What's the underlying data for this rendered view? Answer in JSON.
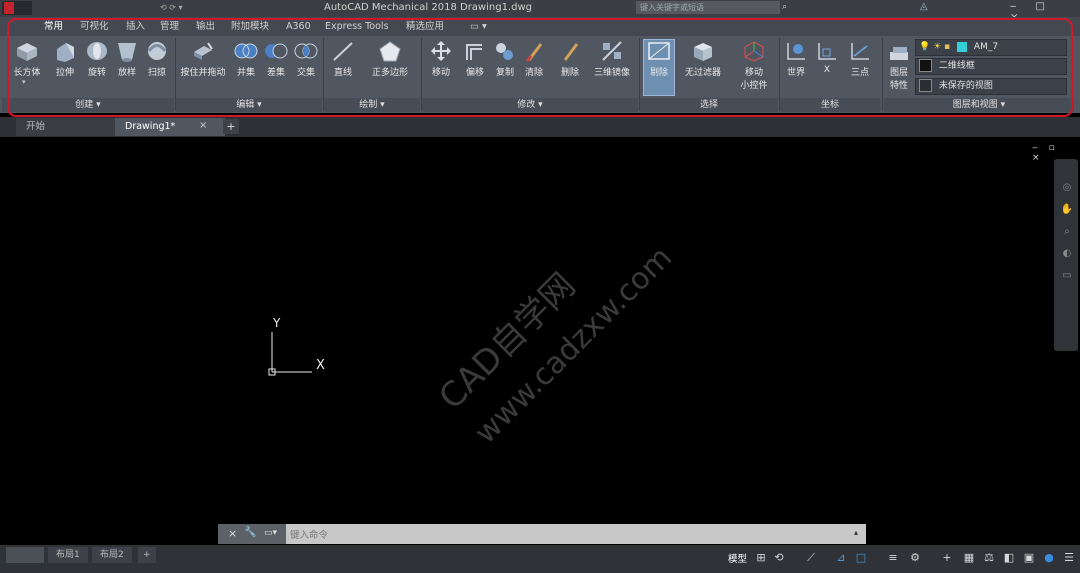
{
  "titlebar": {
    "title": "AutoCAD Mechanical 2018      Drawing1.dwg",
    "search_placeholder": "键入关键字或短语"
  },
  "ribbon_tabs": [
    "常用",
    "可视化",
    "插入",
    "管理",
    "输出",
    "附加模块",
    "A360",
    "Express Tools",
    "精选应用",
    "▭ ▾"
  ],
  "panels": {
    "create": {
      "title": "创建 ▾",
      "tools": [
        "长方体",
        "拉伸",
        "旋转",
        "放样",
        "扫掠"
      ]
    },
    "edit": {
      "title": "编辑 ▾",
      "tools": [
        "按住并拖动",
        "并集",
        "差集",
        "交集"
      ]
    },
    "draw": {
      "title": "绘制 ▾",
      "tools": [
        "直线",
        "正多边形"
      ]
    },
    "modify": {
      "title": "修改 ▾",
      "tools": [
        "移动",
        "偏移",
        "复制",
        "清除",
        "删除",
        "三维镜像"
      ]
    },
    "select": {
      "title": "选择",
      "tools": [
        "剔除",
        "无过滤器",
        "移动",
        "小控件"
      ]
    },
    "coords": {
      "title": "坐标",
      "tools": [
        "世界",
        "X",
        "三点"
      ]
    },
    "layers": {
      "title": "图层和视图 ▾",
      "layer_props": "图层",
      "layer_props2": "特性",
      "layer_name": "AM_7",
      "visual_style": "二维线框",
      "view_name": "未保存的视图"
    }
  },
  "doc_tabs": {
    "start": "开始",
    "drawing": "Drawing1*",
    "add": "+"
  },
  "canvas": {
    "ucs_y": "Y",
    "ucs_x": "X",
    "watermark_line1": "CAD自学网",
    "watermark_line2": "www.cadzxw.com"
  },
  "command": {
    "placeholder": "键入命令"
  },
  "statusbar": {
    "layout1": "布局1",
    "layout2": "布局2",
    "add": "+",
    "model": "模型"
  },
  "colors": {
    "highlight": "#d0182a",
    "layer_swatch": "#35d0d6",
    "accent": "#2a7fd4"
  }
}
